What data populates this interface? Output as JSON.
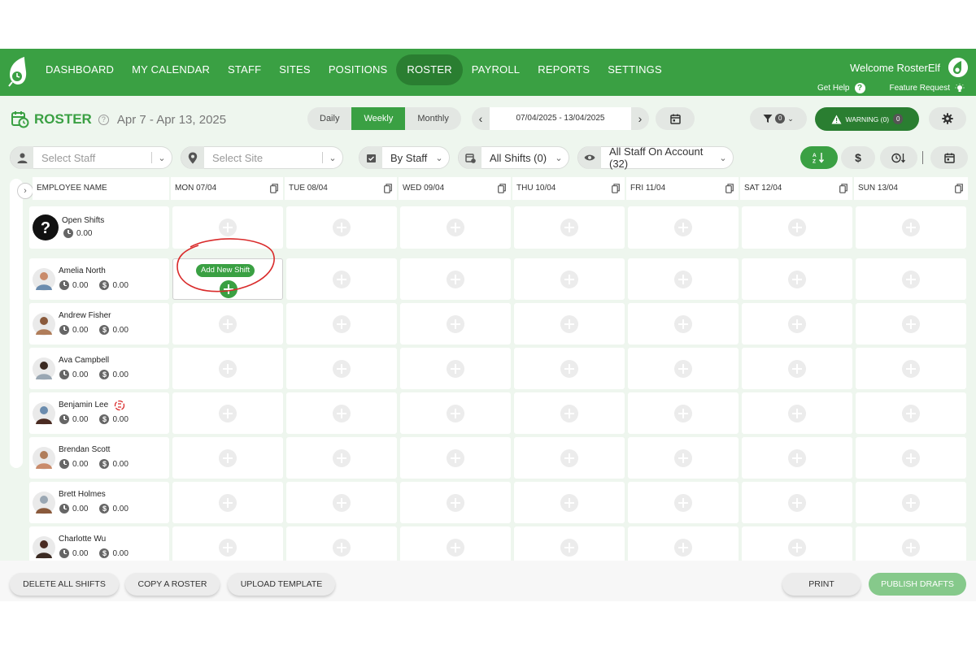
{
  "nav": {
    "items": [
      "DASHBOARD",
      "MY CALENDAR",
      "STAFF",
      "SITES",
      "POSITIONS",
      "ROSTER",
      "PAYROLL",
      "REPORTS",
      "SETTINGS"
    ],
    "active": "ROSTER",
    "welcome": "Welcome RosterElf",
    "get_help": "Get Help",
    "feature_request": "Feature Request"
  },
  "header": {
    "title": "ROSTER",
    "date_range": "Apr 7 - Apr 13, 2025",
    "views": [
      "Daily",
      "Weekly",
      "Monthly"
    ],
    "active_view": "Weekly",
    "date_field": "07/04/2025 - 13/04/2025",
    "filter_count": "0",
    "warning_label": "WARNING (0)",
    "warning_count": "0"
  },
  "filters": {
    "staff_placeholder": "Select Staff",
    "site_placeholder": "Select Site",
    "group_by": "By Staff",
    "shifts": "All Shifts (0)",
    "visibility": "All Staff On Account (32)"
  },
  "grid": {
    "employee_header": "EMPLOYEE NAME",
    "days": [
      "MON 07/04",
      "TUE 08/04",
      "WED 09/04",
      "THU 10/04",
      "FRI 11/04",
      "SAT 12/04",
      "SUN 13/04"
    ],
    "open_shifts": {
      "name": "Open Shifts",
      "hours": "0.00"
    },
    "employees": [
      {
        "name": "Amelia North",
        "hours": "0.00",
        "cost": "0.00"
      },
      {
        "name": "Andrew Fisher",
        "hours": "0.00",
        "cost": "0.00"
      },
      {
        "name": "Ava Campbell",
        "hours": "0.00",
        "cost": "0.00"
      },
      {
        "name": "Benjamin Lee",
        "hours": "0.00",
        "cost": "0.00"
      },
      {
        "name": "Brendan Scott",
        "hours": "0.00",
        "cost": "0.00"
      },
      {
        "name": "Brett Holmes",
        "hours": "0.00",
        "cost": "0.00"
      },
      {
        "name": "Charlotte Wu",
        "hours": "0.00",
        "cost": "0.00"
      }
    ],
    "add_new_shift": "Add New Shift"
  },
  "footer": {
    "delete_all": "DELETE ALL SHIFTS",
    "copy_roster": "COPY A ROSTER",
    "upload_template": "UPLOAD TEMPLATE",
    "print": "PRINT",
    "publish": "PUBLISH DRAFTS"
  },
  "colors": {
    "brand": "#3aa043",
    "brand_dark": "#2a7e31",
    "annotation": "#d92b2b"
  }
}
